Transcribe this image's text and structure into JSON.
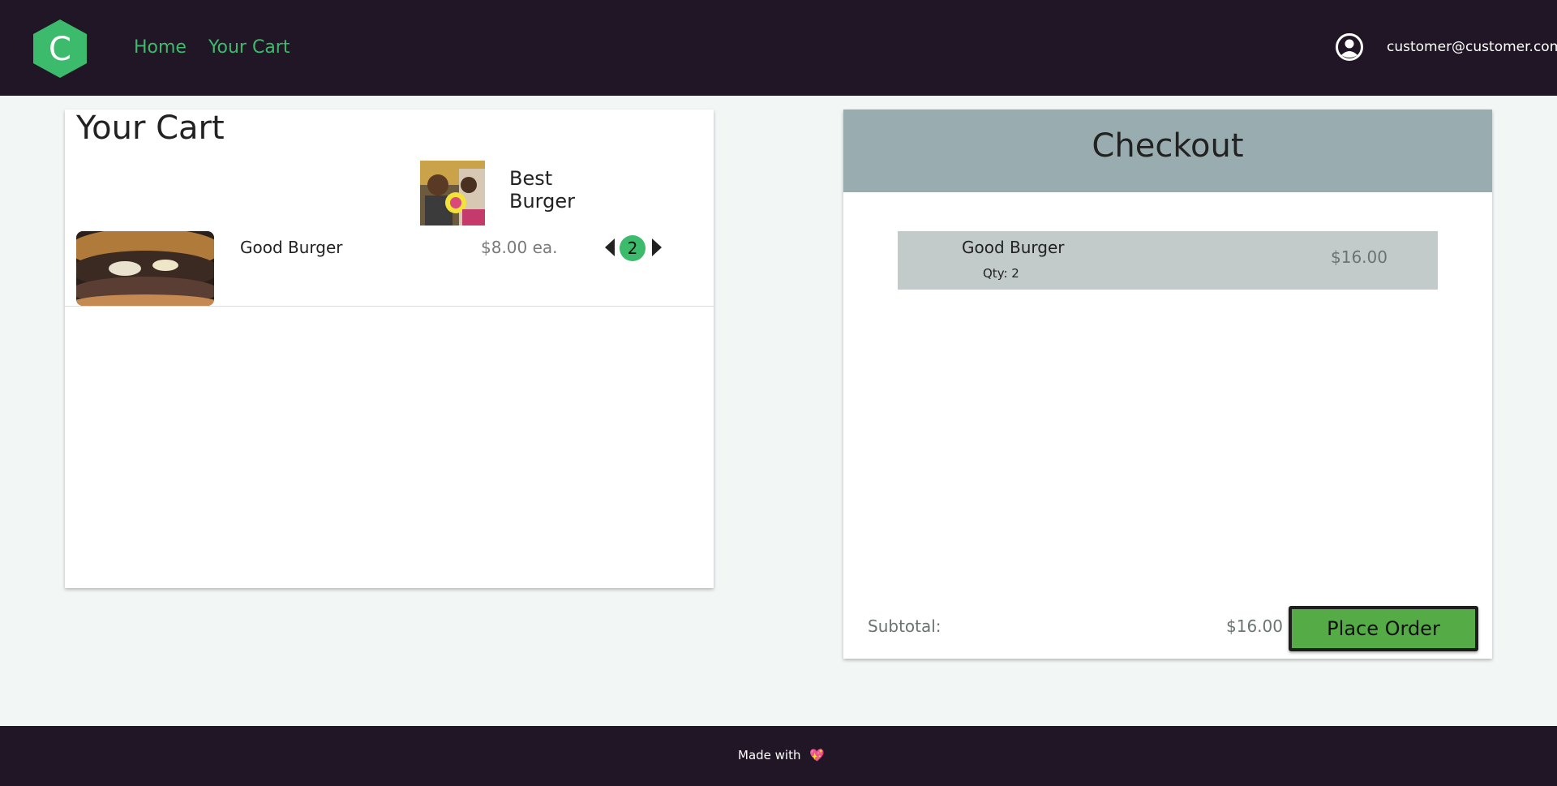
{
  "header": {
    "logo_letter": "C",
    "nav": [
      {
        "label": "Home"
      },
      {
        "label": "Your Cart"
      }
    ],
    "user_email": "customer@customer.com",
    "colors": {
      "bar": "#211625",
      "accent": "#3dbb6c"
    }
  },
  "cart": {
    "title": "Your Cart",
    "promo": {
      "name": "Best Burger"
    },
    "items": [
      {
        "name": "Good Burger",
        "price": "$8.00 ea.",
        "quantity": "2"
      }
    ]
  },
  "checkout": {
    "title": "Checkout",
    "lines": [
      {
        "name": "Good Burger",
        "qty_label": "Qty: 2",
        "total": "$16.00"
      }
    ],
    "subtotal_label": "Subtotal:",
    "subtotal_value": "$16.00",
    "place_order_label": "Place Order",
    "colors": {
      "header": "#99adb0",
      "line": "#c2cbc9",
      "button": "#55ab45"
    }
  },
  "footer": {
    "text": "Made with",
    "heart": "💖"
  },
  "icons": [
    "hexagon-logo-icon",
    "user-circle-icon",
    "caret-left-icon",
    "caret-right-icon",
    "heart-icon"
  ]
}
